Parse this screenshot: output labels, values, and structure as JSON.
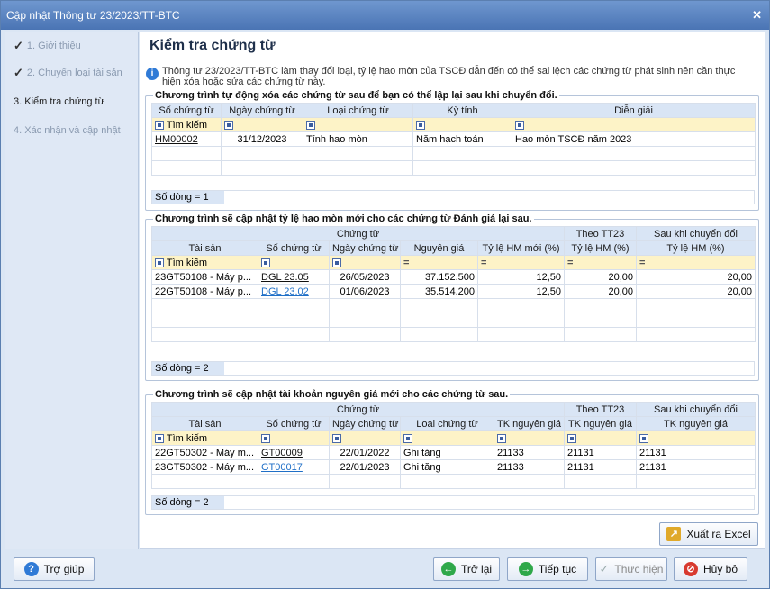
{
  "window": {
    "title": "Cập nhật Thông tư 23/2023/TT-BTC"
  },
  "steps": [
    {
      "label": "1. Giới thiệu",
      "done": true
    },
    {
      "label": "2. Chuyển loại tài sản",
      "done": true
    },
    {
      "label": "3. Kiểm tra chứng từ",
      "current": true
    },
    {
      "label": "4. Xác nhận và cập nhật"
    }
  ],
  "main": {
    "title": "Kiểm tra chứng từ",
    "info": "Thông tư 23/2023/TT-BTC làm thay đổi loại, tỷ lệ hao mòn của TSCĐ dẫn đến có thể sai lệch các chứng từ phát sinh nên cần thực hiện xóa hoặc sửa các chứng từ này."
  },
  "grid1": {
    "title": "Chương trình tự động xóa các chứng từ sau để bạn có thể lập lại sau khi chuyển đổi.",
    "headers": [
      "Số chứng từ",
      "Ngày chứng từ",
      "Loại chứng từ",
      "Kỳ tính",
      "Diễn giải"
    ],
    "filter_label": "Tìm kiếm",
    "rows": [
      [
        "HM00002",
        "31/12/2023",
        "Tính hao mòn",
        "Năm hạch toán",
        "Hao mòn TSCĐ năm 2023"
      ]
    ],
    "count": "Số dòng = 1"
  },
  "grid2": {
    "title": "Chương trình sẽ cập nhật tỷ lệ hao mòn mới cho các chứng từ Đánh giá lại sau.",
    "group_headers": [
      "Chứng từ",
      "Theo TT23",
      "Sau khi chuyển đổi"
    ],
    "headers": [
      "Tài sản",
      "Số chứng từ",
      "Ngày chứng từ",
      "Nguyên giá",
      "Tỷ lệ HM mới (%)",
      "Tỷ lệ HM (%)",
      "Tỷ lệ HM (%)"
    ],
    "filter_label": "Tìm kiếm",
    "rows": [
      [
        "23GT50108 - Máy p...",
        "DGL 23.05",
        "26/05/2023",
        "37.152.500",
        "12,50",
        "20,00",
        "20,00"
      ],
      [
        "22GT50108 - Máy p...",
        "DGL 23.02",
        "01/06/2023",
        "35.514.200",
        "12,50",
        "20,00",
        "20,00"
      ]
    ],
    "count": "Số dòng = 2"
  },
  "grid3": {
    "title": "Chương trình sẽ cập nhật tài khoản nguyên giá mới cho các chứng từ sau.",
    "group_headers": [
      "Chứng từ",
      "Theo TT23",
      "Sau khi chuyển đổi"
    ],
    "headers": [
      "Tài sản",
      "Số chứng từ",
      "Ngày chứng từ",
      "Loại chứng từ",
      "TK nguyên giá",
      "TK nguyên giá",
      "TK nguyên giá"
    ],
    "filter_label": "Tìm kiếm",
    "rows": [
      [
        "22GT50302 - Máy m...",
        "GT00009",
        "22/01/2022",
        "Ghi tăng",
        "21133",
        "21131",
        "21131"
      ],
      [
        "23GT50302 - Máy m...",
        "GT00017",
        "22/01/2023",
        "Ghi tăng",
        "21133",
        "21131",
        "21131"
      ]
    ],
    "count": "Số dòng = 2"
  },
  "buttons": {
    "export": "Xuất ra Excel",
    "help": "Trợ giúp",
    "back": "Trở lại",
    "next": "Tiếp tục",
    "execute": "Thực hiện",
    "cancel": "Hủy bỏ"
  },
  "colors": {
    "titlebar": "#4a74b4",
    "accent": "#1f6fc7",
    "filter_row": "#fdf3c7"
  }
}
